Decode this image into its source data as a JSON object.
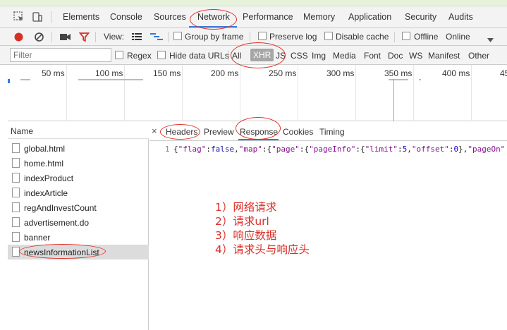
{
  "panel_tabs": [
    "Elements",
    "Console",
    "Sources",
    "Network",
    "Performance",
    "Memory",
    "Application",
    "Security",
    "Audits"
  ],
  "toolbar": {
    "view_label": "View:",
    "group_by_frame": "Group by frame",
    "preserve_log": "Preserve log",
    "disable_cache": "Disable cache",
    "offline": "Offline",
    "throttle": "Online"
  },
  "filter": {
    "placeholder": "Filter",
    "regex": "Regex",
    "hide_data_urls": "Hide data URLs",
    "types": [
      "All",
      "XHR",
      "JS",
      "CSS",
      "Img",
      "Media",
      "Font",
      "Doc",
      "WS",
      "Manifest",
      "Other"
    ],
    "active_type": "XHR"
  },
  "timeline": {
    "ticks": [
      "50 ms",
      "100 ms",
      "150 ms",
      "200 ms",
      "250 ms",
      "300 ms",
      "350 ms",
      "400 ms",
      "45"
    ]
  },
  "requests": {
    "header": "Name",
    "items": [
      "global.html",
      "home.html",
      "indexProduct",
      "indexArticle",
      "regAndInvestCount",
      "advertisement.do",
      "banner",
      "newsInformationList"
    ],
    "selected": "newsInformationList"
  },
  "detail": {
    "close": "×",
    "tabs": [
      "Headers",
      "Preview",
      "Response",
      "Cookies",
      "Timing"
    ],
    "active_tab": "Response",
    "line_number": "1",
    "response_text": "{\"flag\":false,\"map\":{\"page\":{\"pageInfo\":{\"limit\":5,\"offset\":0},\"pageOn\":"
  },
  "annotations": [
    "1）网络请求",
    "2）请求url",
    "3）响应数据",
    "4）请求头与响应头"
  ],
  "colors": {
    "record_red": "#d93025",
    "filter_red": "#d93025",
    "annotation_red": "#d9302b",
    "active_blue": "#3879d9"
  }
}
